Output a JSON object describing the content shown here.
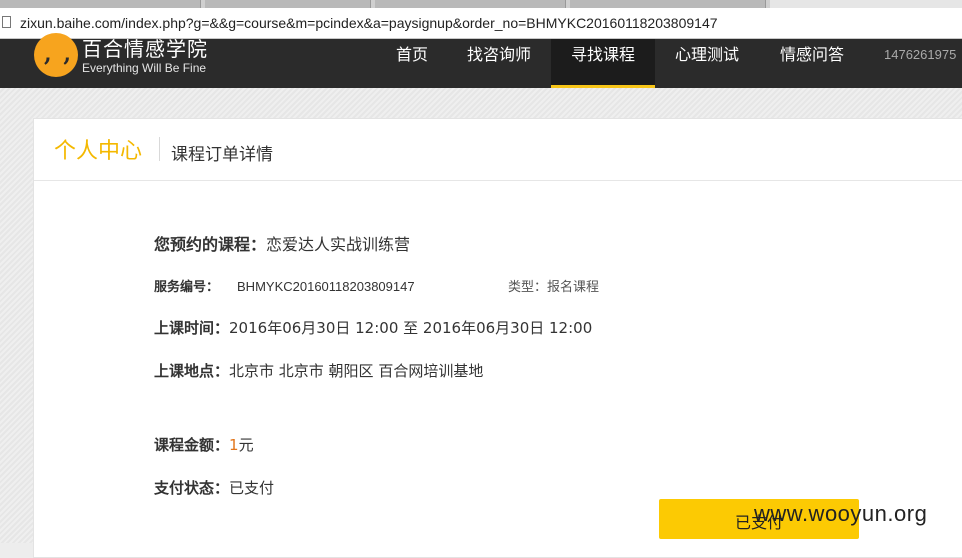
{
  "browser": {
    "url": "zixun.baihe.com/index.php?g=&&g=course&m=pcindex&a=paysignup&order_no=BHMYKC20160118203809147"
  },
  "nav": {
    "logo_title": "百合情感学院",
    "logo_subtitle": "Everything Will Be Fine",
    "logo_mark": ", ,",
    "items": [
      {
        "label": "首页"
      },
      {
        "label": "找咨询师"
      },
      {
        "label": "寻找课程",
        "active": true
      },
      {
        "label": "心理测试"
      },
      {
        "label": "情感问答"
      }
    ],
    "user": "1476261975"
  },
  "panel": {
    "title": "个人中心",
    "subtitle": "课程订单详情"
  },
  "order": {
    "course_label": "您预约的课程：",
    "course_value": "恋爱达人实战训练营",
    "service_label": "服务编号：",
    "service_value": "BHMYKC20160118203809147",
    "type_text": "类型：报名课程",
    "time_label": "上课时间：",
    "time_value": "2016年06月30日 12:00 至 2016年06月30日 12:00",
    "place_label": "上课地点：",
    "place_value": "北京市 北京市 朝阳区 百合网培训基地",
    "amount_label": "课程金额：",
    "amount_number": "1",
    "amount_unit": "元",
    "status_label": "支付状态：",
    "status_value": "已支付"
  },
  "pay_button": "已支付",
  "watermark": "www.wooyun.org",
  "colors": {
    "accent": "#f4b800",
    "button": "#fcca03",
    "nav_bg": "#2b2b2b",
    "amount": "#e2761b"
  }
}
